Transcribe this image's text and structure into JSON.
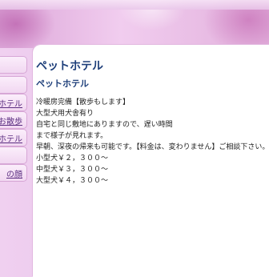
{
  "sidebar": {
    "items": [
      {
        "label": ""
      },
      {
        "label": ""
      },
      {
        "label": "ホテル"
      },
      {
        "label": "お散歩"
      },
      {
        "label": "ホテル"
      },
      {
        "label": ""
      },
      {
        "label": "の顔"
      }
    ]
  },
  "main": {
    "title": "ペットホテル",
    "subtitle": "ペットホテル",
    "lines": [
      "冷暖房完備【散歩もします】",
      "大型犬用犬舎有り",
      "自宅と同じ敷地にありますので、遅い時間",
      "まで様子が見れます。",
      "早朝、深夜の帰来も可能です。【料金は、変わりません】ご相談下さい。",
      "小型犬￥２，３００〜",
      "中型犬￥３，３００〜",
      "大型犬￥４，３００〜"
    ]
  }
}
